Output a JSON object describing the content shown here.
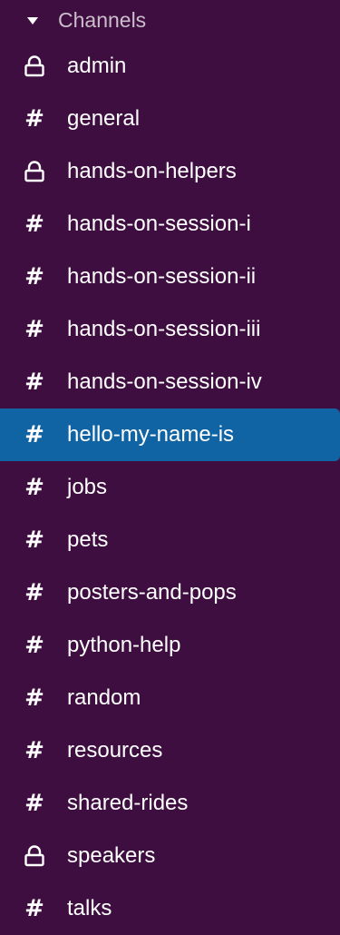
{
  "sidebar": {
    "section_title": "Channels",
    "channels": [
      {
        "label": "admin",
        "icon": "lock-icon",
        "active": false
      },
      {
        "label": "general",
        "icon": "hash-icon",
        "active": false
      },
      {
        "label": "hands-on-helpers",
        "icon": "lock-icon",
        "active": false
      },
      {
        "label": "hands-on-session-i",
        "icon": "hash-icon",
        "active": false
      },
      {
        "label": "hands-on-session-ii",
        "icon": "hash-icon",
        "active": false
      },
      {
        "label": "hands-on-session-iii",
        "icon": "hash-icon",
        "active": false
      },
      {
        "label": "hands-on-session-iv",
        "icon": "hash-icon",
        "active": false
      },
      {
        "label": "hello-my-name-is",
        "icon": "hash-icon",
        "active": true
      },
      {
        "label": "jobs",
        "icon": "hash-icon",
        "active": false
      },
      {
        "label": "pets",
        "icon": "hash-icon",
        "active": false
      },
      {
        "label": "posters-and-pops",
        "icon": "hash-icon",
        "active": false
      },
      {
        "label": "python-help",
        "icon": "hash-icon",
        "active": false
      },
      {
        "label": "random",
        "icon": "hash-icon",
        "active": false
      },
      {
        "label": "resources",
        "icon": "hash-icon",
        "active": false
      },
      {
        "label": "shared-rides",
        "icon": "hash-icon",
        "active": false
      },
      {
        "label": "speakers",
        "icon": "lock-icon",
        "active": false
      },
      {
        "label": "talks",
        "icon": "hash-icon",
        "active": false
      }
    ]
  },
  "colors": {
    "background": "#3f0e40",
    "active": "#1164a3",
    "text": "#ffffff",
    "section_text": "#cbbecb"
  }
}
